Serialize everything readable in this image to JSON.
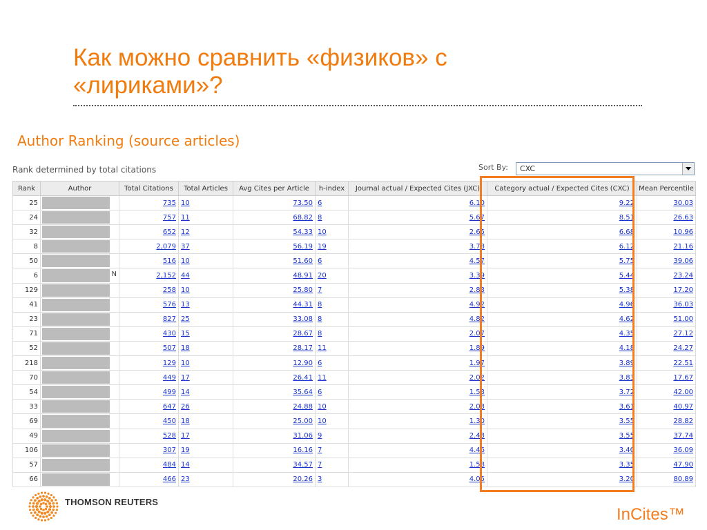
{
  "slide": {
    "title": "Как можно сравнить «физиков» с «лириками»?",
    "section_title": "Author Ranking (source articles)",
    "rank_note": "Rank determined by total citations"
  },
  "sort": {
    "label": "Sort By:",
    "value": "CXC"
  },
  "table": {
    "columns": [
      "Rank",
      "Author",
      "Total Citations",
      "Total Articles",
      "Avg Cites per Article",
      "h-index",
      "Journal actual / Expected Cites (JXC)",
      "Category actual / Expected Cites (CXC)",
      "Mean Percentile"
    ],
    "rows": [
      {
        "rank": "25",
        "author": "",
        "total_citations": "735",
        "total_articles": "10",
        "avg_cites": "73.50",
        "h_index": "6",
        "jxc": "6.10",
        "cxc": "9.22",
        "mean_percentile": "30.03"
      },
      {
        "rank": "24",
        "author": "",
        "total_citations": "757",
        "total_articles": "11",
        "avg_cites": "68.82",
        "h_index": "8",
        "jxc": "5.67",
        "cxc": "8.51",
        "mean_percentile": "26.63"
      },
      {
        "rank": "32",
        "author": "",
        "total_citations": "652",
        "total_articles": "12",
        "avg_cites": "54.33",
        "h_index": "10",
        "jxc": "2.65",
        "cxc": "6.68",
        "mean_percentile": "10.96"
      },
      {
        "rank": "8",
        "author": "",
        "total_citations": "2,079",
        "total_articles": "37",
        "avg_cites": "56.19",
        "h_index": "19",
        "jxc": "3.78",
        "cxc": "6.12",
        "mean_percentile": "21.16"
      },
      {
        "rank": "50",
        "author": "",
        "total_citations": "516",
        "total_articles": "10",
        "avg_cites": "51.60",
        "h_index": "6",
        "jxc": "4.57",
        "cxc": "5.75",
        "mean_percentile": "39.06"
      },
      {
        "rank": "6",
        "author": "N",
        "total_citations": "2,152",
        "total_articles": "44",
        "avg_cites": "48.91",
        "h_index": "20",
        "jxc": "3.39",
        "cxc": "5.44",
        "mean_percentile": "23.24"
      },
      {
        "rank": "129",
        "author": "",
        "total_citations": "258",
        "total_articles": "10",
        "avg_cites": "25.80",
        "h_index": "7",
        "jxc": "2.83",
        "cxc": "5.38",
        "mean_percentile": "17.20"
      },
      {
        "rank": "41",
        "author": "",
        "total_citations": "576",
        "total_articles": "13",
        "avg_cites": "44.31",
        "h_index": "8",
        "jxc": "4.92",
        "cxc": "4.96",
        "mean_percentile": "36.03"
      },
      {
        "rank": "23",
        "author": "",
        "total_citations": "827",
        "total_articles": "25",
        "avg_cites": "33.08",
        "h_index": "8",
        "jxc": "4.82",
        "cxc": "4.62",
        "mean_percentile": "51.00"
      },
      {
        "rank": "71",
        "author": "",
        "total_citations": "430",
        "total_articles": "15",
        "avg_cites": "28.67",
        "h_index": "8",
        "jxc": "2.07",
        "cxc": "4.35",
        "mean_percentile": "27.12"
      },
      {
        "rank": "52",
        "author": "",
        "total_citations": "507",
        "total_articles": "18",
        "avg_cites": "28.17",
        "h_index": "11",
        "jxc": "1.89",
        "cxc": "4.18",
        "mean_percentile": "24.27"
      },
      {
        "rank": "218",
        "author": "",
        "total_citations": "129",
        "total_articles": "10",
        "avg_cites": "12.90",
        "h_index": "6",
        "jxc": "1.97",
        "cxc": "3.89",
        "mean_percentile": "22.51"
      },
      {
        "rank": "70",
        "author": "",
        "total_citations": "449",
        "total_articles": "17",
        "avg_cites": "26.41",
        "h_index": "11",
        "jxc": "2.02",
        "cxc": "3.83",
        "mean_percentile": "17.67"
      },
      {
        "rank": "54",
        "author": "",
        "total_citations": "499",
        "total_articles": "14",
        "avg_cites": "35.64",
        "h_index": "6",
        "jxc": "1.53",
        "cxc": "3.72",
        "mean_percentile": "42.00"
      },
      {
        "rank": "33",
        "author": "",
        "total_citations": "647",
        "total_articles": "26",
        "avg_cites": "24.88",
        "h_index": "10",
        "jxc": "2.03",
        "cxc": "3.61",
        "mean_percentile": "40.97"
      },
      {
        "rank": "69",
        "author": "",
        "total_citations": "450",
        "total_articles": "18",
        "avg_cites": "25.00",
        "h_index": "10",
        "jxc": "1.30",
        "cxc": "3.55",
        "mean_percentile": "28.82"
      },
      {
        "rank": "49",
        "author": "",
        "total_citations": "528",
        "total_articles": "17",
        "avg_cites": "31.06",
        "h_index": "9",
        "jxc": "2.43",
        "cxc": "3.55",
        "mean_percentile": "37.74"
      },
      {
        "rank": "106",
        "author": "",
        "total_citations": "307",
        "total_articles": "19",
        "avg_cites": "16.16",
        "h_index": "7",
        "jxc": "4.46",
        "cxc": "3.40",
        "mean_percentile": "36.09"
      },
      {
        "rank": "57",
        "author": "",
        "total_citations": "484",
        "total_articles": "14",
        "avg_cites": "34.57",
        "h_index": "7",
        "jxc": "1.58",
        "cxc": "3.35",
        "mean_percentile": "47.90"
      },
      {
        "rank": "66",
        "author": "",
        "total_citations": "466",
        "total_articles": "23",
        "avg_cites": "20.26",
        "h_index": "3",
        "jxc": "4.05",
        "cxc": "3.20",
        "mean_percentile": "80.89"
      }
    ]
  },
  "footer": {
    "brand": "THOMSON REUTERS",
    "product": "InCites™",
    "logo_icon": "thomson-reuters-logo-icon"
  },
  "colors": {
    "accent_orange": "#f07c10",
    "highlight_border": "#f47d20",
    "link_blue": "#1a33cc",
    "header_gray": "#ececec",
    "redaction_gray": "#bcbcbc"
  }
}
